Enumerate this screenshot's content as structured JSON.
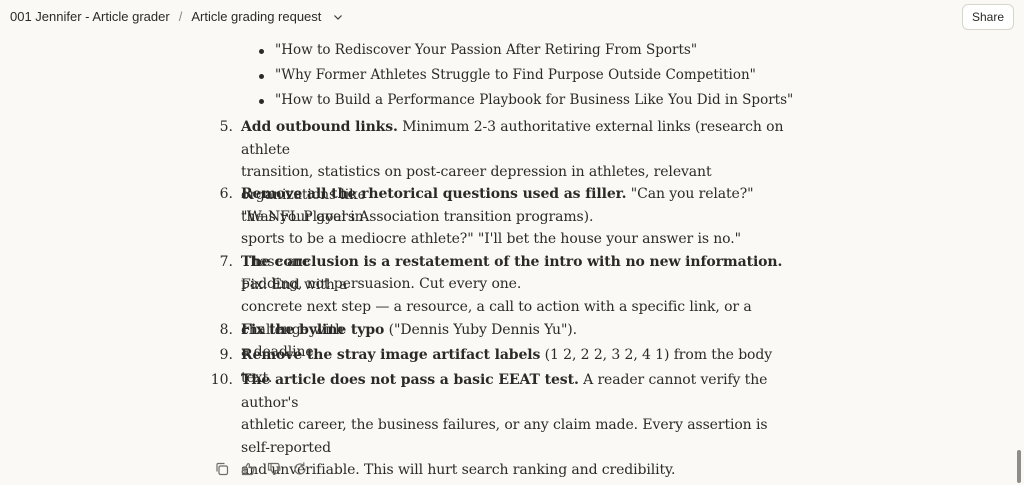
{
  "header": {
    "project": "001 Jennifer - Article grader",
    "separator": "/",
    "conversation": "Article grading request",
    "share_label": "Share"
  },
  "bullets": [
    "\"How to Rediscover Your Passion After Retiring From Sports\"",
    "\"Why Former Athletes Struggle to Find Purpose Outside Competition\"",
    "\"How to Build a Performance Playbook for Business Like You Did in Sports\""
  ],
  "items": [
    {
      "num": "5.",
      "bold": "Add outbound links.",
      "lines": [
        "Minimum 2-3 authoritative external links (research on athlete",
        "transition, statistics on post-career depression in athletes, relevant organizations like",
        "the NFL Players Association transition programs)."
      ]
    },
    {
      "num": "6.",
      "bold": "Remove all the rhetorical questions used as filler.",
      "lines": [
        "\"Can you relate?\" \"Was your goal in",
        "sports to be a mediocre athlete?\" \"I'll bet the house your answer is no.\" These are",
        "padding, not persuasion. Cut every one."
      ]
    },
    {
      "num": "7.",
      "bold": "The conclusion is a restatement of the intro with no new information.",
      "lines": [
        "Fix: End with a",
        "concrete next step — a resource, a call to action with a specific link, or a challenge with",
        "a deadline."
      ]
    },
    {
      "num": "8.",
      "bold": "Fix the byline typo",
      "lines": [
        "(\"Dennis Yuby Dennis Yu\")."
      ]
    },
    {
      "num": "9.",
      "bold": "Remove the stray image artifact labels",
      "lines": [
        "(1 2, 2 2, 3 2, 4 1) from the body text."
      ]
    },
    {
      "num": "10.",
      "bold": "The article does not pass a basic EEAT test.",
      "lines": [
        "A reader cannot verify the author's",
        "athletic career, the business failures, or any claim made. Every assertion is self-reported",
        "and unverifiable. This will hurt search ranking and credibility."
      ]
    }
  ],
  "icons": [
    "copy-icon",
    "thumbs-up-icon",
    "thumbs-down-icon",
    "retry-icon"
  ]
}
